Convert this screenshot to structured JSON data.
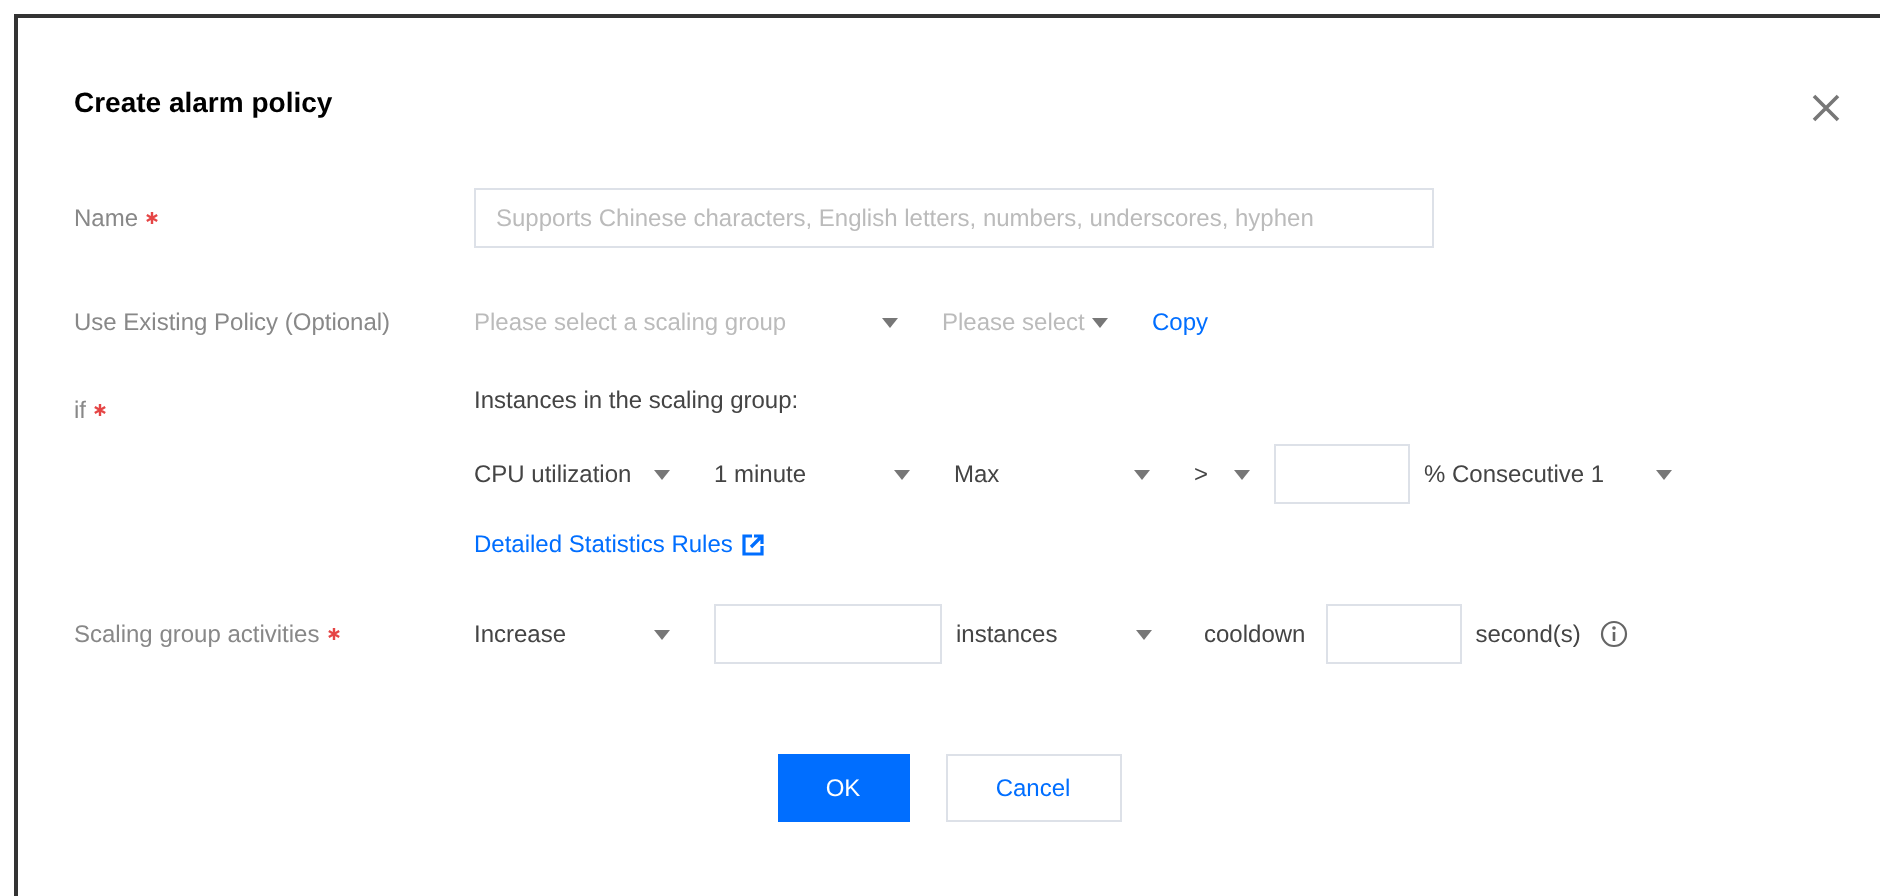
{
  "dialog": {
    "title": "Create alarm policy"
  },
  "name_field": {
    "label": "Name",
    "required": true,
    "placeholder": "Supports Chinese characters, English letters, numbers, underscores, hyphen"
  },
  "existing_policy": {
    "label": "Use Existing Policy (Optional)",
    "required": false,
    "group_select": {
      "placeholder": "Please select a scaling group"
    },
    "policy_select": {
      "placeholder": "Please select"
    },
    "copy_link": "Copy"
  },
  "condition": {
    "label": "if",
    "required": true,
    "caption": "Instances in the scaling group:",
    "metric": "CPU utilization",
    "period": "1 minute",
    "statistic": "Max",
    "operator": ">",
    "unit_select": "% Consecutive 1",
    "rules_link": "Detailed Statistics Rules"
  },
  "activity": {
    "label": "Scaling group activities",
    "required": true,
    "action": "Increase",
    "unit": "instances",
    "cooldown_label": "cooldown",
    "seconds_label": "second(s)"
  },
  "buttons": [
    {
      "label": "OK",
      "kind": "primary"
    },
    {
      "label": "Cancel",
      "kind": "default"
    }
  ]
}
